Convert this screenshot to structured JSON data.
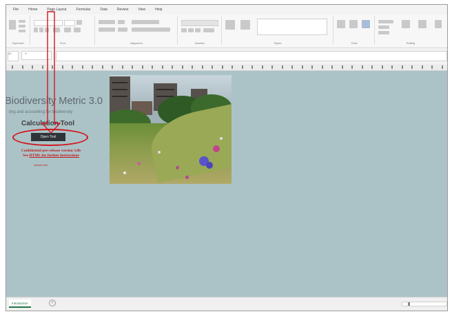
{
  "menu": [
    "File",
    "Home",
    "Page Layout",
    "Formulas",
    "Data",
    "Review",
    "View",
    "Help"
  ],
  "ribbon_groups": [
    "Clipboard",
    "Font",
    "Alignment",
    "Number",
    "Styles",
    "Cells",
    "Editing"
  ],
  "name_box": "A1",
  "formula_label": "fx",
  "sheet": {
    "title": "e Biodiversity Metric 3.0",
    "subtitle": "ting and accounting for biodiversity",
    "calc_tool": "Calculation Tool",
    "open_button": "Open Tool",
    "warning_line1": "Confidential pre-release version 3.0b",
    "warning_line2_pre": "See ",
    "warning_link": "HTML for further instructions",
    "small_note": "version info"
  },
  "sheet_tab": "Introduction",
  "add_sheet": "+",
  "colors": {
    "sheet_bg": "#abc3c6",
    "annotation_red": "#d1161e",
    "button_dark": "#2f3439"
  }
}
